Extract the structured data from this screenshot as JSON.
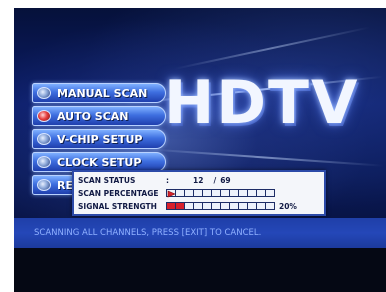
{
  "logo": {
    "text": "HDTV"
  },
  "menu": {
    "items": [
      {
        "label": "MANUAL SCAN",
        "active": false
      },
      {
        "label": "AUTO SCAN",
        "active": true
      },
      {
        "label": "V-CHIP SETUP",
        "active": false
      },
      {
        "label": "CLOCK SETUP",
        "active": false
      },
      {
        "label": "RE",
        "active": false
      }
    ]
  },
  "scan_dialog": {
    "status_label": "SCAN STATUS",
    "status_colon": ":",
    "status_current": "12",
    "status_separator": "/",
    "status_total": "69",
    "percentage_label": "SCAN PERCENTAGE",
    "percentage_cells_total": 12,
    "percentage_progress": 0.0,
    "signal_label": "SIGNAL STRENGTH",
    "signal_cells_total": 12,
    "signal_value_text": "20%",
    "signal_fraction": 0.2
  },
  "footer": {
    "message": "SCANNING ALL CHANNELS, PRESS [EXIT] TO CANCEL."
  },
  "colors": {
    "menu_gradient_top": "#7fb0ff",
    "menu_gradient_bottom": "#1f3fae",
    "signal_fill": "#d7202c",
    "footer_bar": "#2447b8",
    "footer_text": "#8fb0ff"
  }
}
